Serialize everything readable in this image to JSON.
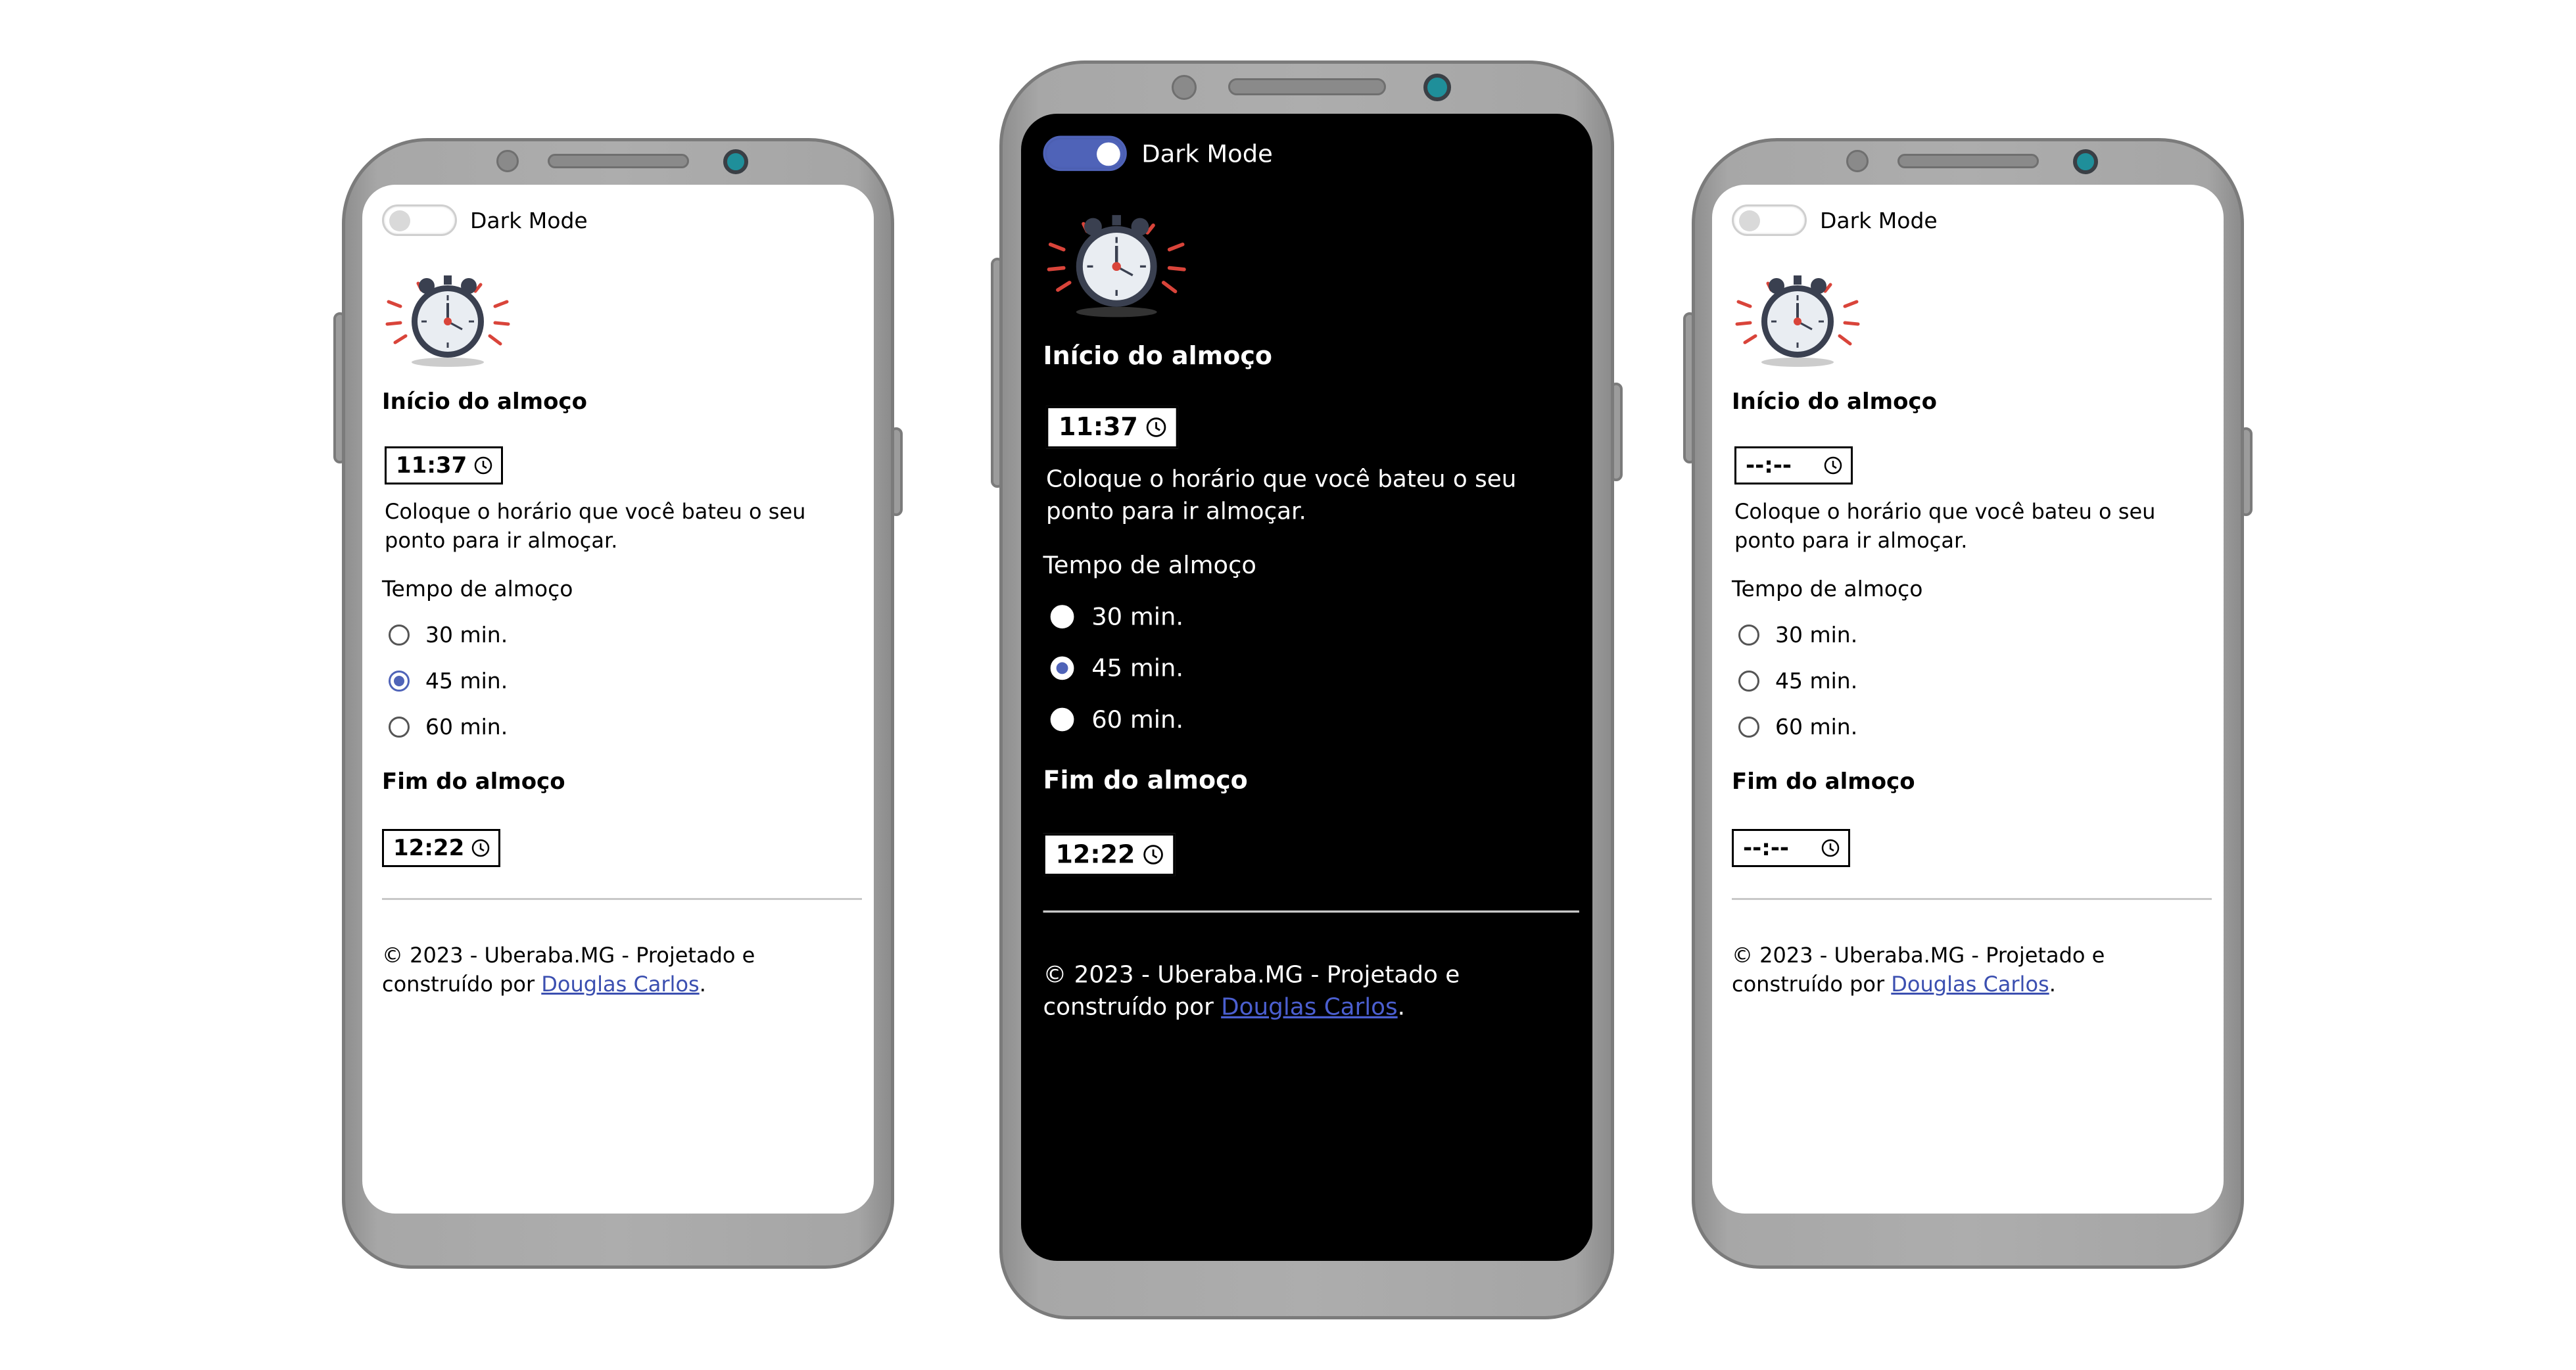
{
  "phones": [
    {
      "id": "left",
      "theme": "light",
      "dark_mode_label": "Dark Mode",
      "dark_mode_on": false,
      "start_heading": "Início do almoço",
      "start_time": "11:37",
      "description": "Coloque o horário que você bateu o seu ponto para ir almoçar.",
      "tempo_label": "Tempo de almoço",
      "options": [
        "30 min.",
        "45 min.",
        "60 min."
      ],
      "selected_option": "45 min.",
      "end_heading": "Fim do almoço",
      "end_time": "12:22",
      "footer_text": "© 2023 - Uberaba.MG - Projetado e construído por ",
      "footer_link": "Douglas Carlos",
      "footer_end": "."
    },
    {
      "id": "center",
      "theme": "dark",
      "dark_mode_label": "Dark Mode",
      "dark_mode_on": true,
      "start_heading": "Início do almoço",
      "start_time": "11:37",
      "description": "Coloque o horário que você bateu o seu ponto para ir almoçar.",
      "tempo_label": "Tempo de almoço",
      "options": [
        "30 min.",
        "45 min.",
        "60 min."
      ],
      "selected_option": "45 min.",
      "end_heading": "Fim do almoço",
      "end_time": "12:22",
      "footer_text": "© 2023 - Uberaba.MG - Projetado e construído por ",
      "footer_link": "Douglas Carlos",
      "footer_end": "."
    },
    {
      "id": "right",
      "theme": "light",
      "dark_mode_label": "Dark Mode",
      "dark_mode_on": false,
      "start_heading": "Início do almoço",
      "start_time": "--:--",
      "description": "Coloque o horário que você bateu o seu ponto para ir almoçar.",
      "tempo_label": "Tempo de almoço",
      "options": [
        "30 min.",
        "45 min.",
        "60 min."
      ],
      "selected_option": "",
      "end_heading": "Fim do almoço",
      "end_time": "--:--",
      "footer_text": "© 2023 - Uberaba.MG - Projetado e construído por ",
      "footer_link": "Douglas Carlos",
      "footer_end": "."
    }
  ],
  "colors": {
    "accent": "#4f63b8",
    "link": "#3b4fb0",
    "frame": "#a9a9a9",
    "camera": "#1f8f9a",
    "dark_bg": "#000000",
    "light_bg": "#ffffff"
  }
}
